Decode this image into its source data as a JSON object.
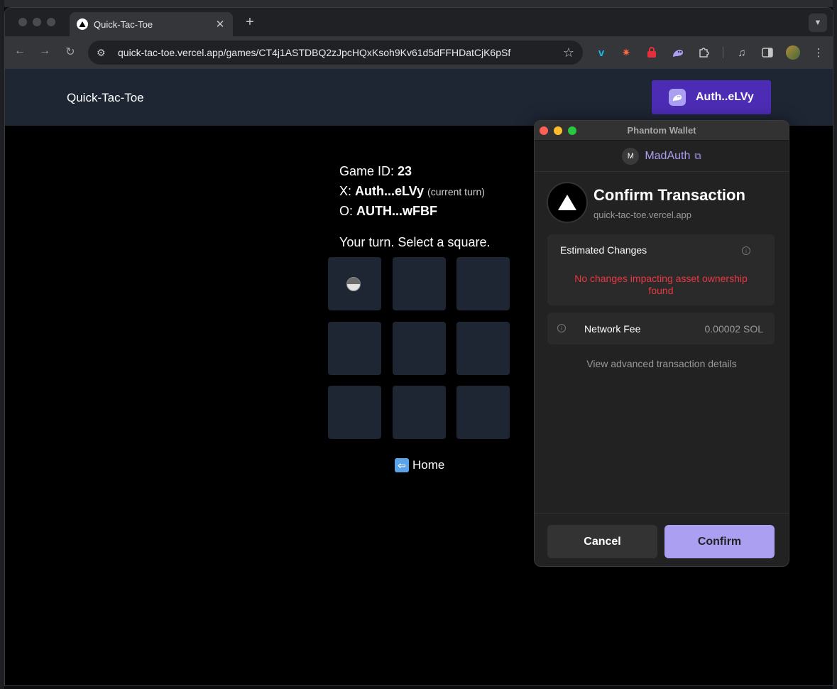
{
  "browser": {
    "tab_title": "Quick-Tac-Toe",
    "url": "quick-tac-toe.vercel.app/games/CT4j1ASTDBQ2zJpcHQxKsoh9Kv61d5dFFHDatCjK6pSf",
    "icons": [
      "back-icon",
      "forward-icon",
      "reload-icon",
      "site-settings-icon",
      "star-icon",
      "vimeo-icon",
      "burst-icon",
      "lock-extension-icon",
      "phantom-icon",
      "puzzle-icon",
      "media-icon",
      "sidebar-icon",
      "profile-avatar",
      "menu-icon"
    ]
  },
  "site": {
    "title": "Quick-Tac-Toe",
    "wallet_label": "Auth..eLVy"
  },
  "game": {
    "id_label": "Game ID: ",
    "id_value": "23",
    "x_label": "X: ",
    "x_player": "Auth...eLVy",
    "x_note": "(current turn)",
    "o_label": "O: ",
    "o_player": "AUTH...wFBF",
    "status": "Your turn. Select a square.",
    "home_label": "Home"
  },
  "phantom": {
    "window_title": "Phantom Wallet",
    "account_initial": "M",
    "account_name": "MadAuth",
    "heading": "Confirm Transaction",
    "domain": "quick-tac-toe.vercel.app",
    "estimated_changes_title": "Estimated Changes",
    "estimated_changes_warning": "No changes impacting asset ownership found",
    "fee_label": "Network Fee",
    "fee_value": "0.00002 SOL",
    "advanced_link": "View advanced transaction details",
    "cancel_label": "Cancel",
    "confirm_label": "Confirm"
  },
  "colors": {
    "header_bg": "#1e2533",
    "wallet_button": "#4c2cb4",
    "phantom_accent": "#ab9ff2",
    "warning_red": "#eb3742"
  }
}
